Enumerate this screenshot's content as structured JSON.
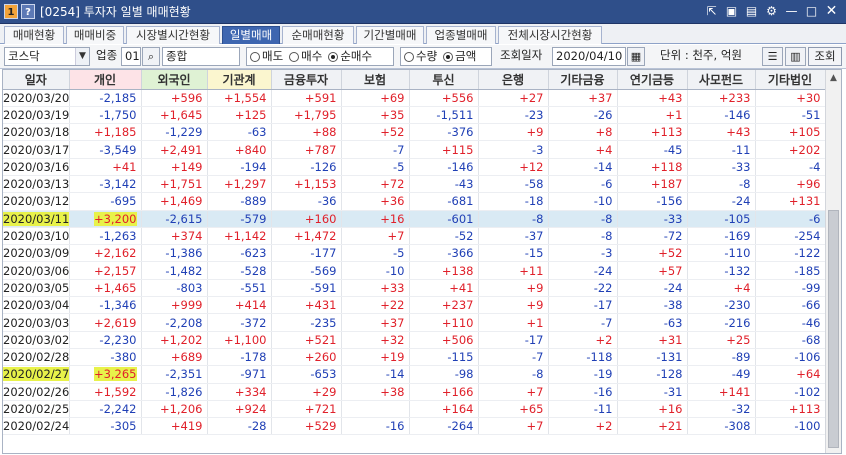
{
  "window": {
    "badge_one": "1",
    "badge_q": "?",
    "title": "[0254] 투자자 일별 매매현황",
    "icons": [
      "pin-icon",
      "save-icon",
      "print-icon",
      "settings-icon",
      "minimize-icon",
      "maximize-icon",
      "close-icon"
    ],
    "icon_glyphs": [
      "⇱",
      "▣",
      "▤",
      "⚙",
      "—",
      "□",
      "✕"
    ]
  },
  "tabs": [
    {
      "label": "매매현황",
      "active": false
    },
    {
      "label": "매매비중",
      "active": false
    },
    {
      "label": "시장별시간현황",
      "active": false
    },
    {
      "label": "일별매매",
      "active": true
    },
    {
      "label": "순매매현황",
      "active": false
    },
    {
      "label": "기간별매매",
      "active": false
    },
    {
      "label": "업종별매매",
      "active": false
    },
    {
      "label": "전체시장시간현황",
      "active": false
    }
  ],
  "toolbar": {
    "market_select": "코스닥",
    "sector_label": "업종",
    "sector_code": "01",
    "sector_name": "종합",
    "trade_type": {
      "options": [
        "매도",
        "매수",
        "순매수"
      ],
      "selected": "순매수"
    },
    "unit_type": {
      "options": [
        "수량",
        "금액"
      ],
      "selected": "금액"
    },
    "date_label": "조회일자",
    "date_value": "2020/04/10",
    "unit_text": "단위 : 천주, 억원",
    "search_button": "조회"
  },
  "colors": {
    "positive": "#e0202a",
    "negative": "#1f3fb5",
    "highlight": "#e8f24a",
    "selected_row": "#d9eaf4",
    "active_tab": "#3e66b0"
  },
  "table": {
    "headers": [
      "일자",
      "개인",
      "외국인",
      "기관계",
      "금융투자",
      "보험",
      "투신",
      "은행",
      "기타금융",
      "연기금등",
      "사모펀드",
      "기타법인"
    ],
    "rows": [
      [
        "2020/03/20",
        "-2,185",
        "+596",
        "+1,554",
        "+591",
        "+69",
        "+556",
        "+27",
        "+37",
        "+43",
        "+233",
        "+30"
      ],
      [
        "2020/03/19",
        "-1,750",
        "+1,645",
        "+125",
        "+1,795",
        "+35",
        "-1,511",
        "-23",
        "-26",
        "+1",
        "-146",
        "-51"
      ],
      [
        "2020/03/18",
        "+1,185",
        "-1,229",
        "-63",
        "+88",
        "+52",
        "-376",
        "+9",
        "+8",
        "+113",
        "+43",
        "+105"
      ],
      [
        "2020/03/17",
        "-3,549",
        "+2,491",
        "+840",
        "+787",
        "-7",
        "+115",
        "-3",
        "+4",
        "-45",
        "-11",
        "+202"
      ],
      [
        "2020/03/16",
        "+41",
        "+149",
        "-194",
        "-126",
        "-5",
        "-146",
        "+12",
        "-14",
        "+118",
        "-33",
        "-4"
      ],
      [
        "2020/03/13",
        "-3,142",
        "+1,751",
        "+1,297",
        "+1,153",
        "+72",
        "-43",
        "-58",
        "-6",
        "+187",
        "-8",
        "+96"
      ],
      [
        "2020/03/12",
        "-695",
        "+1,469",
        "-889",
        "-36",
        "+36",
        "-681",
        "-18",
        "-10",
        "-156",
        "-24",
        "+131"
      ],
      [
        "2020/03/11",
        "+3,200",
        "-2,615",
        "-579",
        "+160",
        "+16",
        "-601",
        "-8",
        "-8",
        "-33",
        "-105",
        "-6"
      ],
      [
        "2020/03/10",
        "-1,263",
        "+374",
        "+1,142",
        "+1,472",
        "+7",
        "-52",
        "-37",
        "-8",
        "-72",
        "-169",
        "-254"
      ],
      [
        "2020/03/09",
        "+2,162",
        "-1,386",
        "-623",
        "-177",
        "-5",
        "-366",
        "-15",
        "-3",
        "+52",
        "-110",
        "-122"
      ],
      [
        "2020/03/06",
        "+2,157",
        "-1,482",
        "-528",
        "-569",
        "-10",
        "+138",
        "+11",
        "-24",
        "+57",
        "-132",
        "-185"
      ],
      [
        "2020/03/05",
        "+1,465",
        "-803",
        "-551",
        "-591",
        "+33",
        "+41",
        "+9",
        "-22",
        "-24",
        "+4",
        "-99"
      ],
      [
        "2020/03/04",
        "-1,346",
        "+999",
        "+414",
        "+431",
        "+22",
        "+237",
        "+9",
        "-17",
        "-38",
        "-230",
        "-66"
      ],
      [
        "2020/03/03",
        "+2,619",
        "-2,208",
        "-372",
        "-235",
        "+37",
        "+110",
        "+1",
        "-7",
        "-63",
        "-216",
        "-46"
      ],
      [
        "2020/03/02",
        "-2,230",
        "+1,202",
        "+1,100",
        "+521",
        "+32",
        "+506",
        "-17",
        "+2",
        "+31",
        "+25",
        "-68"
      ],
      [
        "2020/02/28",
        "-380",
        "+689",
        "-178",
        "+260",
        "+19",
        "-115",
        "-7",
        "-118",
        "-131",
        "-89",
        "-106"
      ],
      [
        "2020/02/27",
        "+3,265",
        "-2,351",
        "-971",
        "-653",
        "-14",
        "-98",
        "-8",
        "-19",
        "-128",
        "-49",
        "+64"
      ],
      [
        "2020/02/26",
        "+1,592",
        "-1,826",
        "+334",
        "+29",
        "+38",
        "+166",
        "+7",
        "-16",
        "-31",
        "+141",
        "-102"
      ],
      [
        "2020/02/25",
        "-2,242",
        "+1,206",
        "+924",
        "+721",
        "",
        "+164",
        "+65",
        "-11",
        "+16",
        "-32",
        "+113"
      ],
      [
        "2020/02/24",
        "-305",
        "+419",
        "-28",
        "+529",
        "-16",
        "-264",
        "+7",
        "+2",
        "+21",
        "-308",
        "-100"
      ]
    ],
    "selected_row_date": "2020/03/11",
    "highlighted_dates": [
      "2020/03/11",
      "2020/02/27"
    ]
  }
}
